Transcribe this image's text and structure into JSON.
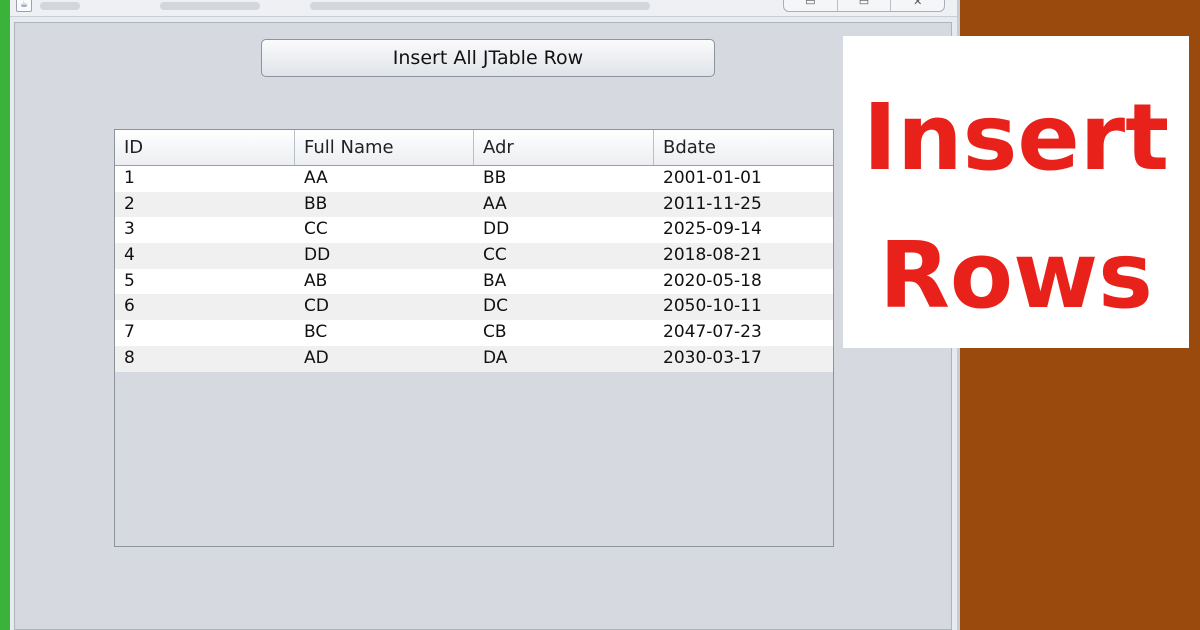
{
  "button": {
    "label": "Insert All JTable Row"
  },
  "table": {
    "columns": [
      "ID",
      "Full Name",
      "Adr",
      "Bdate"
    ],
    "rows": [
      [
        "1",
        "AA",
        "BB",
        "2001-01-01"
      ],
      [
        "2",
        "BB",
        "AA",
        "2011-11-25"
      ],
      [
        "3",
        "CC",
        "DD",
        "2025-09-14"
      ],
      [
        "4",
        "DD",
        "CC",
        "2018-08-21"
      ],
      [
        "5",
        "AB",
        "BA",
        "2020-05-18"
      ],
      [
        "6",
        "CD",
        "DC",
        "2050-10-11"
      ],
      [
        "7",
        "BC",
        "CB",
        "2047-07-23"
      ],
      [
        "8",
        "AD",
        "DA",
        "2030-03-17"
      ]
    ]
  },
  "overlay": {
    "line1": "Insert",
    "line2": "Rows"
  },
  "colors": {
    "overlay_text": "#e8211a",
    "side_green": "#3bb33b",
    "side_brown": "#9a4a0c"
  }
}
